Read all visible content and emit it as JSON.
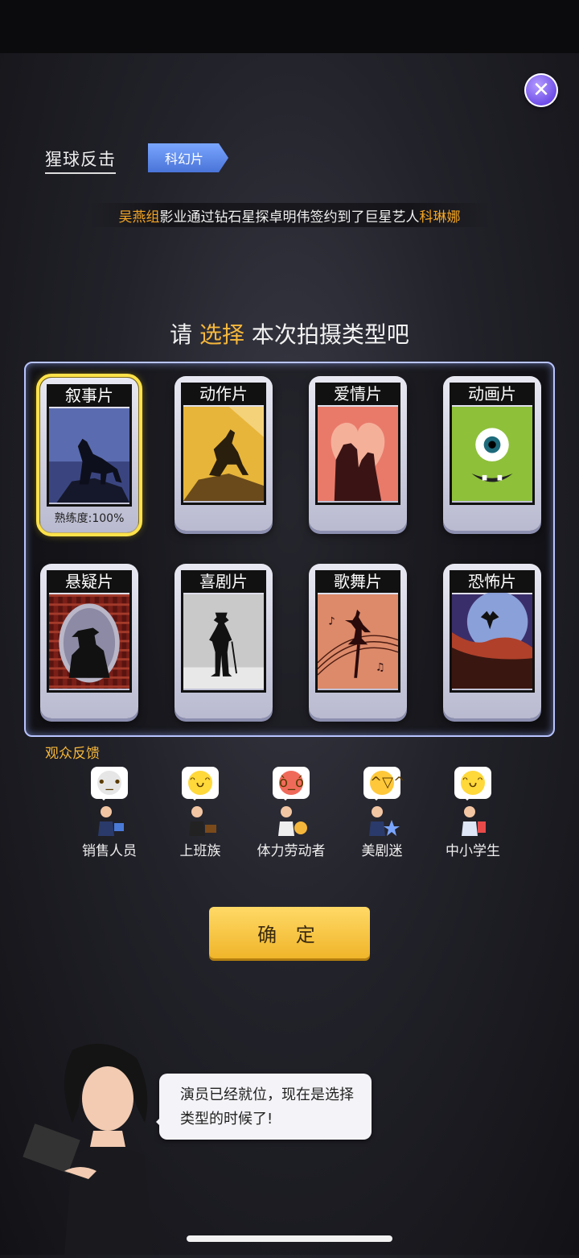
{
  "header": {
    "movie_title": "猩球反击",
    "genre_tag": "科幻片",
    "close_icon": "close-icon"
  },
  "news": {
    "studio": "吴燕组",
    "text_mid": "影业通过钻石星探卓明伟签约到了巨星艺人",
    "star": "科琳娜"
  },
  "prompt": {
    "pre": "请 ",
    "accent": "选择",
    "post": " 本次拍摄类型吧"
  },
  "genres": [
    {
      "label": "叙事片",
      "selected": true,
      "proficiency": "熟练度:100%"
    },
    {
      "label": "动作片"
    },
    {
      "label": "爱情片"
    },
    {
      "label": "动画片"
    },
    {
      "label": "悬疑片"
    },
    {
      "label": "喜剧片"
    },
    {
      "label": "歌舞片"
    },
    {
      "label": "恐怖片"
    }
  ],
  "feedback": {
    "label": "观众反馈",
    "audiences": [
      {
        "name": "销售人员",
        "mood": "neutral"
      },
      {
        "name": "上班族",
        "mood": "happy"
      },
      {
        "name": "体力劳动者",
        "mood": "angry"
      },
      {
        "name": "美剧迷",
        "mood": "laughing"
      },
      {
        "name": "中小学生",
        "mood": "happy"
      }
    ]
  },
  "confirm_label": "确 定",
  "dialog": {
    "text": "演员已经就位，现在是选择类型的时候了!"
  },
  "colors": {
    "accent": "#f5b73b",
    "selected_border": "#ffe24a",
    "close_button": "#6a49e6",
    "genre_tag": "#4a74d8"
  }
}
